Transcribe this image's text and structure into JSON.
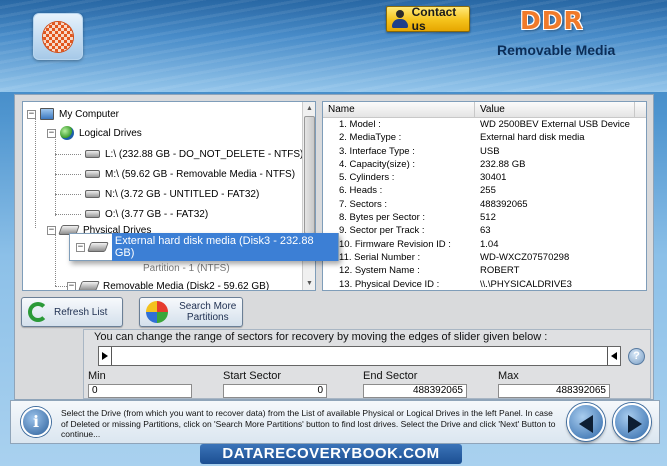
{
  "header": {
    "contact_label": "Contact us",
    "brand": "DDR",
    "subtitle": "Removable Media"
  },
  "tree": {
    "root": "My Computer",
    "logical_group": "Logical Drives",
    "logical_drives": [
      "L:\\ (232.88 GB - DO_NOT_DELETE - NTFS)",
      "M:\\ (59.62 GB - Removable Media - NTFS)",
      "N:\\ (3.72 GB - UNTITLED - FAT32)",
      "O:\\ (3.77 GB -  - FAT32)"
    ],
    "physical_group": "Physical Drives",
    "selected_drive": "External hard disk media (Disk3 - 232.88 GB)",
    "partition_partial": "Partition - 1 (NTFS)",
    "removable_drive": "Removable Media (Disk2 - 59.62 GB)"
  },
  "properties": {
    "col_name": "Name",
    "col_value": "Value",
    "rows": [
      {
        "name": "1. Model :",
        "value": "WD 2500BEV External USB Device"
      },
      {
        "name": "2. MediaType :",
        "value": "External hard disk media"
      },
      {
        "name": "3. Interface Type :",
        "value": "USB"
      },
      {
        "name": "4. Capacity(size) :",
        "value": "232.88 GB"
      },
      {
        "name": "5. Cylinders :",
        "value": "30401"
      },
      {
        "name": "6. Heads :",
        "value": "255"
      },
      {
        "name": "7. Sectors :",
        "value": "488392065"
      },
      {
        "name": "8. Bytes per Sector :",
        "value": "512"
      },
      {
        "name": "9. Sector per Track :",
        "value": "63"
      },
      {
        "name": "10. Firmware Revision ID :",
        "value": "1.04"
      },
      {
        "name": "11. Serial Number :",
        "value": "WD-WXCZ07570298"
      },
      {
        "name": "12. System Name :",
        "value": "ROBERT"
      },
      {
        "name": "13. Physical Device ID :",
        "value": "\\\\.\\PHYSICALDRIVE3"
      }
    ]
  },
  "buttons": {
    "refresh": "Refresh List",
    "search_line1": "Search More",
    "search_line2": "Partitions"
  },
  "slider": {
    "message": "You can change the range of sectors for recovery by moving the edges of slider given below :",
    "min_label": "Min",
    "min_value": "0",
    "start_label": "Start Sector",
    "start_value": "0",
    "end_label": "End Sector",
    "end_value": "488392065",
    "max_label": "Max",
    "max_value": "488392065",
    "help": "?"
  },
  "footer": {
    "info_glyph": "i",
    "text": "Select the Drive (from which you want to recover data) from the List of available Physical or Logical Drives in the left Panel. In case of Deleted or missing Partitions, click on 'Search More Partitions' button to find lost drives. Select the Drive and click 'Next' Button to continue..."
  },
  "website": "DATARECOVERYBOOK.COM",
  "colors": {
    "accent": "#3c7fd5",
    "brand": "#f07a2a",
    "header_bg": "#2f78b9"
  }
}
